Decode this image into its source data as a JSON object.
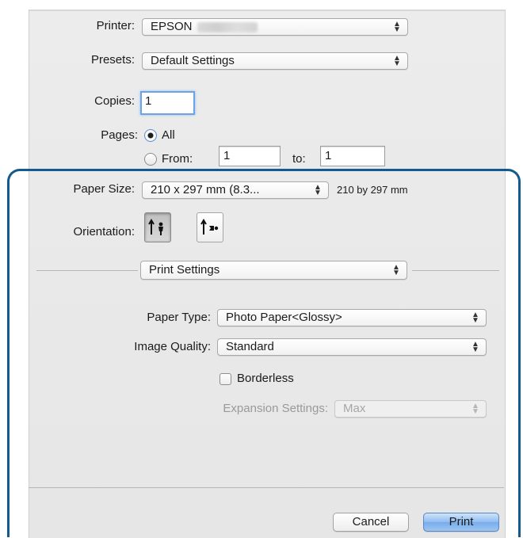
{
  "printer": {
    "label": "Printer:",
    "value": "EPSON"
  },
  "presets": {
    "label": "Presets:",
    "value": "Default Settings"
  },
  "copies": {
    "label": "Copies:",
    "value": "1"
  },
  "pages": {
    "label": "Pages:",
    "all_label": "All",
    "from_label": "From:",
    "from_value": "1",
    "to_label": "to:",
    "to_value": "1"
  },
  "paper_size": {
    "label": "Paper Size:",
    "value": "210 x 297 mm (8.3...",
    "dimensions": "210 by 297 mm"
  },
  "orientation": {
    "label": "Orientation:",
    "selected": "portrait"
  },
  "panel_menu": {
    "value": "Print Settings"
  },
  "print_settings": {
    "paper_type_label": "Paper Type:",
    "paper_type_value": "Photo Paper<Glossy>",
    "image_quality_label": "Image Quality:",
    "image_quality_value": "Standard",
    "borderless_label": "Borderless",
    "borderless_checked": false,
    "expansion_label": "Expansion Settings:",
    "expansion_value": "Max"
  },
  "buttons": {
    "cancel": "Cancel",
    "print": "Print"
  },
  "colors": {
    "highlight_frame": "#135a8f",
    "focus_ring": "#6aa3e6",
    "primary_button": "#78acea"
  }
}
